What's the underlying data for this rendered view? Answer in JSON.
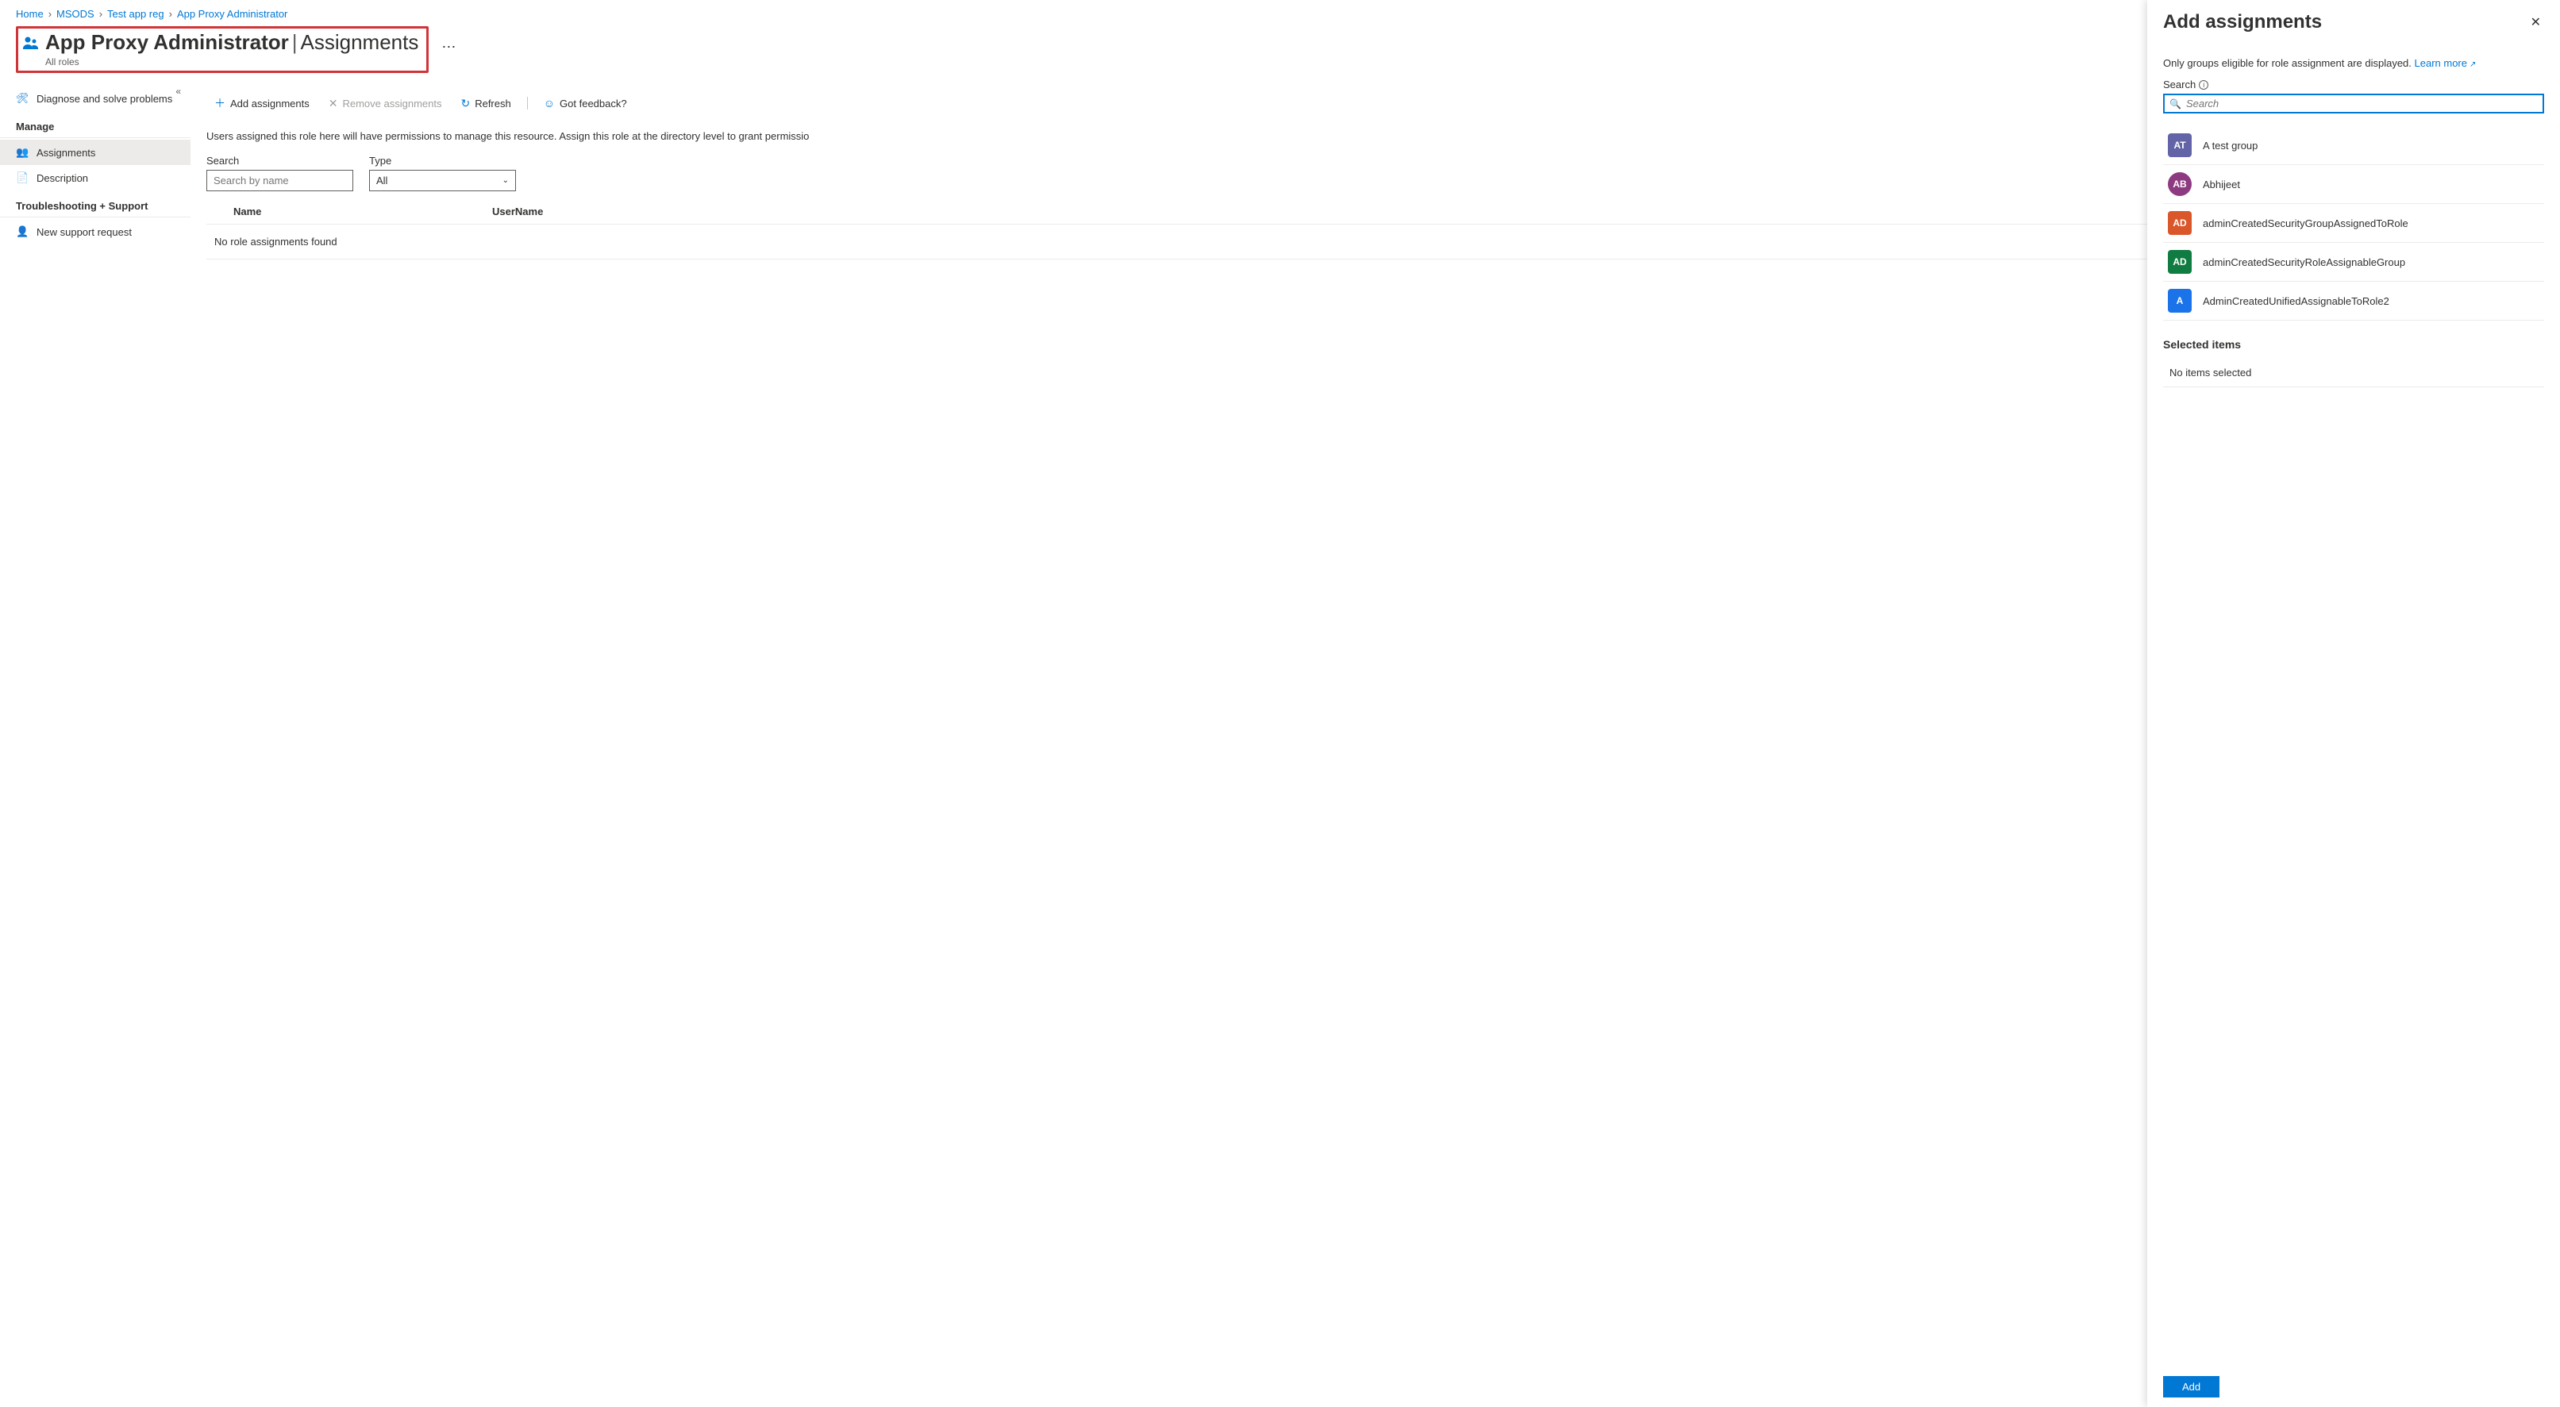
{
  "breadcrumb": {
    "items": [
      {
        "label": "Home"
      },
      {
        "label": "MSODS"
      },
      {
        "label": "Test app reg"
      },
      {
        "label": "App Proxy Administrator"
      }
    ]
  },
  "header": {
    "title": "App Proxy Administrator",
    "subpage": "Assignments",
    "subtitle": "All roles"
  },
  "sidebar": {
    "diagnose": "Diagnose and solve problems",
    "sections": {
      "manage": "Manage",
      "troubleshoot": "Troubleshooting + Support"
    },
    "items": {
      "assignments": "Assignments",
      "description": "Description",
      "newSupport": "New support request"
    }
  },
  "toolbar": {
    "add": "Add assignments",
    "remove": "Remove assignments",
    "refresh": "Refresh",
    "feedback": "Got feedback?"
  },
  "content": {
    "description": "Users assigned this role here will have permissions to manage this resource. Assign this role at the directory level to grant permissio",
    "filters": {
      "searchLabel": "Search",
      "searchPlaceholder": "Search by name",
      "typeLabel": "Type",
      "typeValue": "All"
    },
    "table": {
      "colName": "Name",
      "colUserName": "UserName",
      "empty": "No role assignments found"
    }
  },
  "flyout": {
    "title": "Add assignments",
    "info": "Only groups eligible for role assignment are displayed.",
    "learnMore": "Learn more",
    "searchLabel": "Search",
    "searchPlaceholder": "Search",
    "groups": [
      {
        "initials": "AT",
        "name": "A test group",
        "color": "#6264a7",
        "shape": "square"
      },
      {
        "initials": "AB",
        "name": "Abhijeet",
        "color": "#8e3a80",
        "shape": "circle"
      },
      {
        "initials": "AD",
        "name": "adminCreatedSecurityGroupAssignedToRole",
        "color": "#d9572a",
        "shape": "square"
      },
      {
        "initials": "AD",
        "name": "adminCreatedSecurityRoleAssignableGroup",
        "color": "#107c41",
        "shape": "square"
      },
      {
        "initials": "A",
        "name": "AdminCreatedUnifiedAssignableToRole2",
        "color": "#1a73e8",
        "shape": "square"
      }
    ],
    "selectedHeader": "Selected items",
    "noItems": "No items selected",
    "addButton": "Add"
  }
}
